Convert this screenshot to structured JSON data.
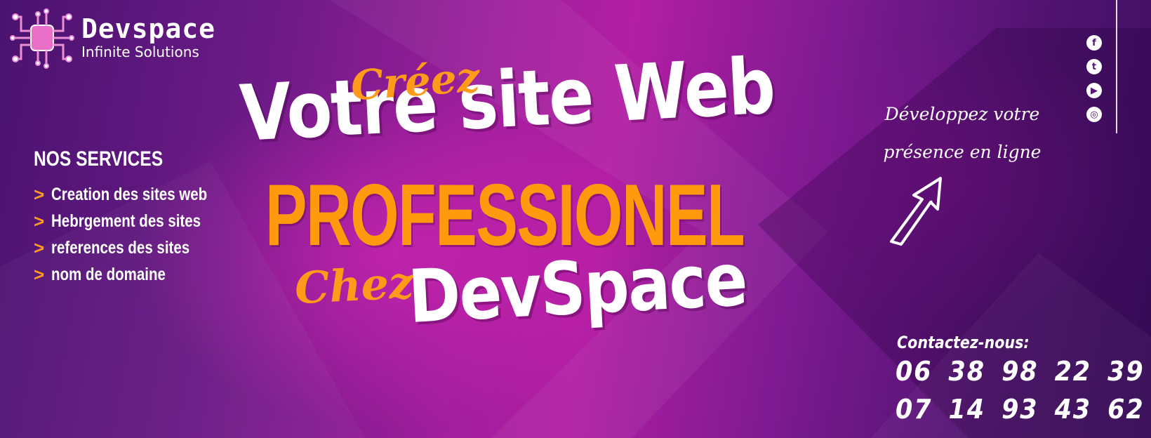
{
  "brand": {
    "name": "Devspace",
    "tagline": "Infinite Solutions",
    "logo_icon": "circuit-chip-icon",
    "accent_color": "#ff9a1a"
  },
  "services": {
    "title": "NOS SERVICES",
    "items": [
      "Creation des sites web",
      "Hebrgement des sites",
      "references des sites",
      "nom de domaine"
    ]
  },
  "headline": {
    "line1_prefix": "Créez",
    "line1": "Votre site Web",
    "line2": "PROFESSIONEL",
    "line3_prefix": "Chez",
    "line3": "DevSpace"
  },
  "tagline": {
    "line1": "Développez votre",
    "line2": "présence en ligne"
  },
  "social": {
    "facebook": "f",
    "twitter": "t",
    "youtube": "▶",
    "instagram": "◎"
  },
  "contact": {
    "title": "Contactez-nous:",
    "phones": [
      "06 38 98 22 39",
      "07 14 93 43 62"
    ]
  }
}
